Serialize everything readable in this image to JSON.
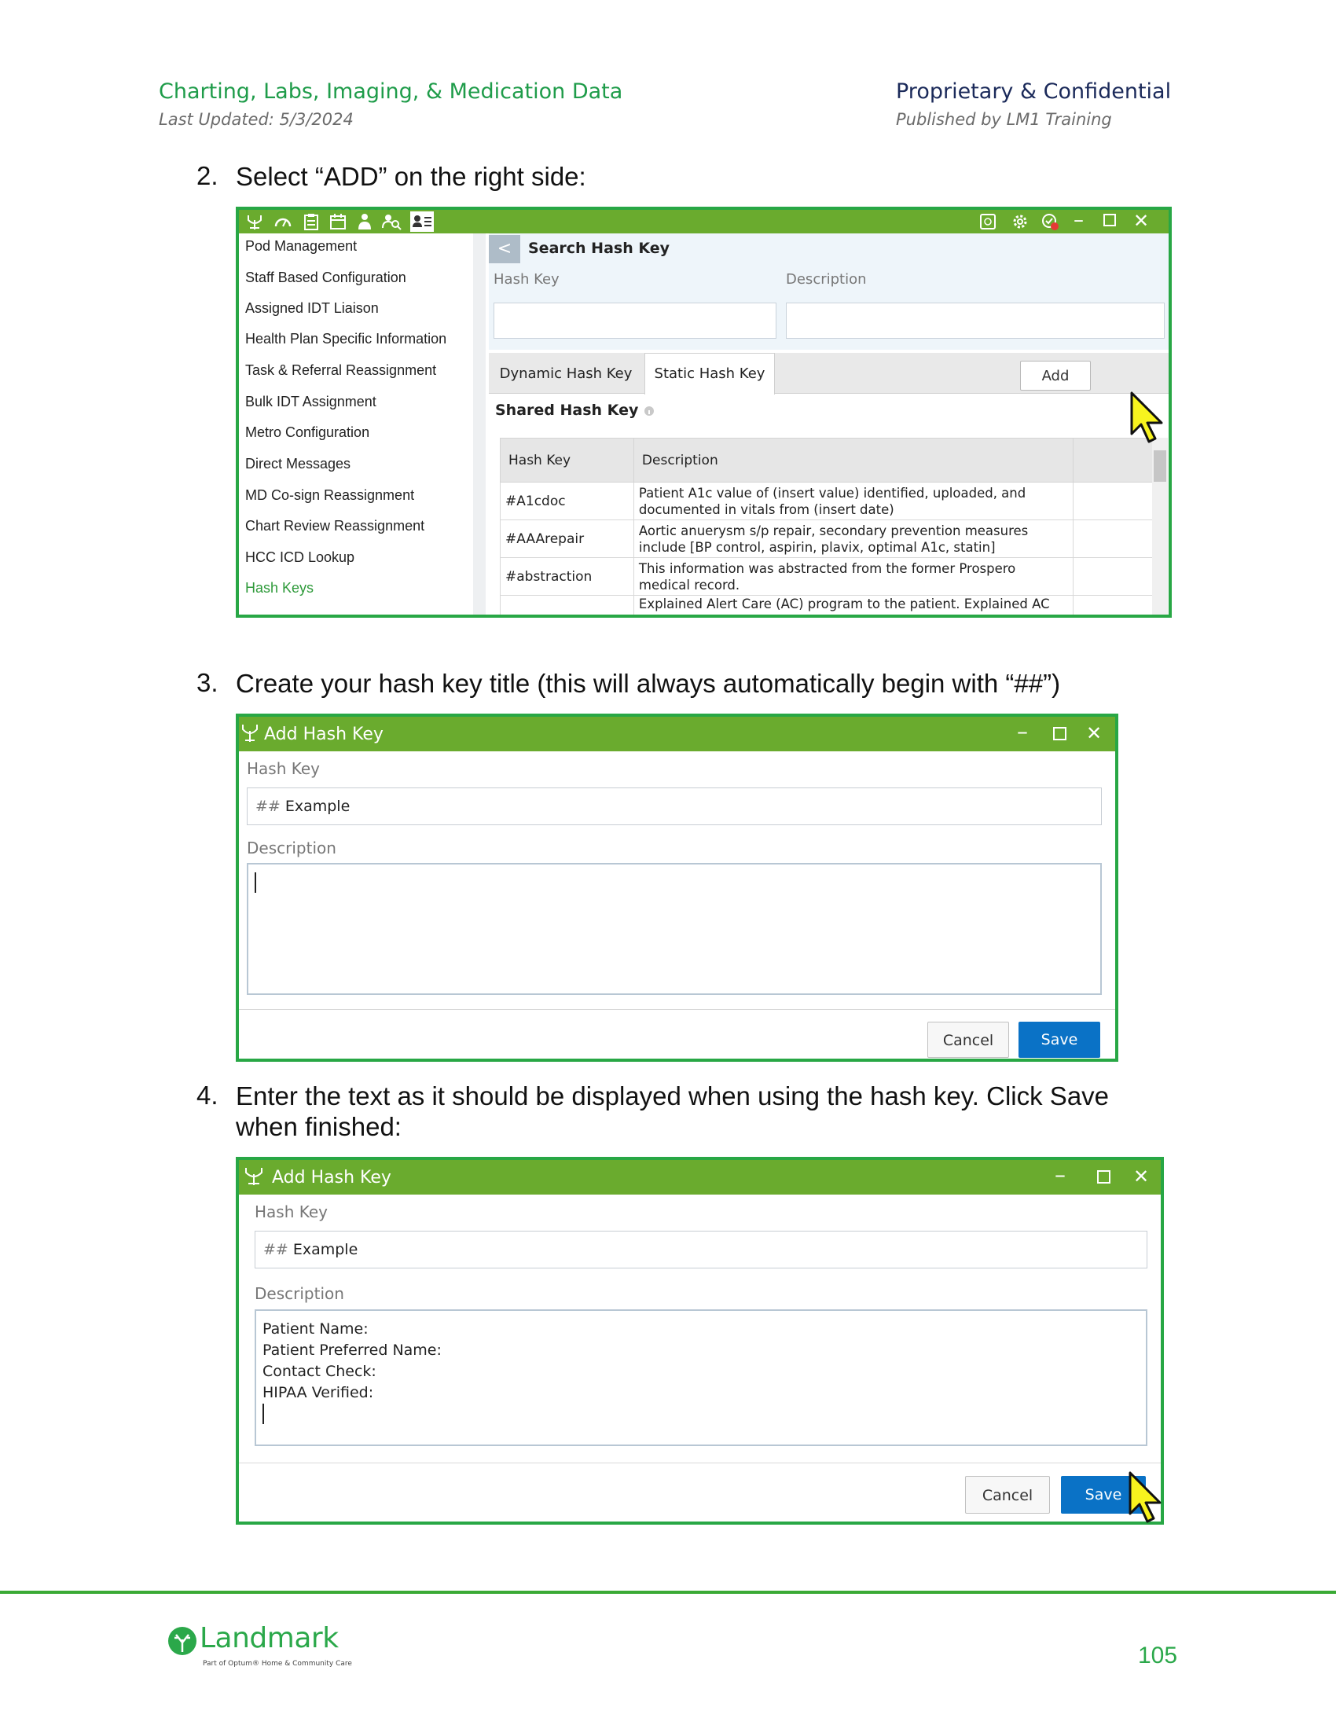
{
  "header": {
    "title": "Charting, Labs, Imaging, & Medication Data",
    "updated": "Last Updated: 5/3/2024",
    "right_title": "Proprietary & Confidential",
    "right_sub": "Published by LM1 Training"
  },
  "steps": [
    {
      "num": "2.",
      "text": "Select “ADD” on the right side:"
    },
    {
      "num": "3.",
      "text": "Create your hash key title (this will always automatically begin with “##”)"
    },
    {
      "num": "4.",
      "text": "Enter the text as it should be displayed when using the hash key. Click Save when finished:"
    }
  ],
  "screen1": {
    "nav_items": [
      "Pod Management",
      "Staff Based Configuration",
      "Assigned IDT Liaison",
      "Health Plan Specific Information",
      "Task & Referral Reassignment",
      "Bulk IDT Assignment",
      "Metro Configuration",
      "Direct Messages",
      "MD Co-sign Reassignment",
      "Chart Review Reassignment",
      "HCC ICD Lookup",
      "Hash Keys"
    ],
    "active_item": "Hash Keys",
    "back_glyph": "<",
    "panel_title": "Search Hash Key",
    "hash_key_label": "Hash Key",
    "description_label": "Description",
    "tabs": [
      "Dynamic Hash Key",
      "Static Hash Key"
    ],
    "active_tab": "Static Hash Key",
    "add_button": "Add",
    "shared_title": "Shared Hash Key",
    "table": {
      "headers": [
        "Hash Key",
        "Description"
      ],
      "rows": [
        {
          "key": "#A1cdoc",
          "desc": "Patient A1c value of (insert value) identified, uploaded, and documented in vitals from (insert date)"
        },
        {
          "key": "#AAArepair",
          "desc": "Aortic anuerysm s/p repair, secondary prevention measures include [BP control, aspirin, plavix, optimal A1c, statin]"
        },
        {
          "key": "#abstraction",
          "desc": "This information was abstracted from the former Prospero medical record."
        },
        {
          "key": "",
          "desc": "Explained Alert Care (AC) program to the patient. Explained AC"
        }
      ]
    }
  },
  "dialog1": {
    "title": "Add Hash Key",
    "hash_key_label": "Hash Key",
    "hash_prefix": "##",
    "hash_value": "Example",
    "description_label": "Description",
    "cancel": "Cancel",
    "save": "Save"
  },
  "dialog2": {
    "title": "Add Hash Key",
    "hash_key_label": "Hash Key",
    "hash_prefix": "##",
    "hash_value": "Example",
    "description_label": "Description",
    "description_lines": [
      "Patient Name:",
      "Patient Preferred Name:",
      "Contact Check:",
      "HIPAA Verified:"
    ],
    "cancel": "Cancel",
    "save": "Save"
  },
  "footer": {
    "logo": "Landmark",
    "logo_sub": "Part of Optum® Home & Community Care",
    "page_number": "105"
  },
  "colors": {
    "frame": "#28a745",
    "titlebar": "#6aab2e",
    "save": "#0a72c6",
    "accent": "#2ba84a"
  }
}
